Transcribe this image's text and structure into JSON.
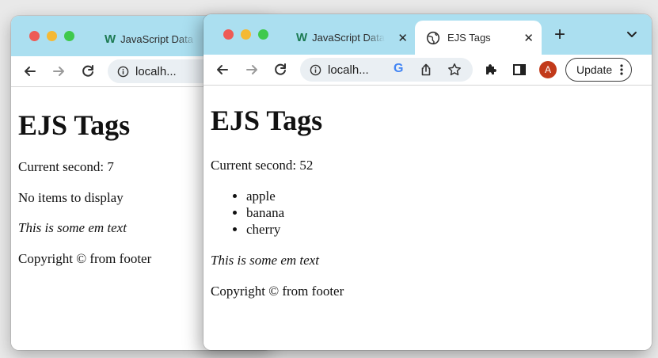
{
  "back_window": {
    "tab_title": "JavaScript Data",
    "address": "localh...",
    "page": {
      "heading": "EJS Tags",
      "current_second": "Current second: 7",
      "empty_message": "No items to display",
      "em_text": "This is some em text",
      "footer": "Copyright © from footer"
    }
  },
  "front_window": {
    "tabs": [
      {
        "title": "JavaScript Data",
        "favicon": "w-icon",
        "active": false
      },
      {
        "title": "EJS Tags",
        "favicon": "globe-icon",
        "active": true
      }
    ],
    "address": "localh...",
    "update_label": "Update",
    "avatar_letter": "A",
    "page": {
      "heading": "EJS Tags",
      "current_second": "Current second: 52",
      "items": [
        "apple",
        "banana",
        "cherry"
      ],
      "em_text": "This is some em text",
      "footer": "Copyright © from footer"
    }
  },
  "colors": {
    "tabstrip": "#abdff0",
    "omnibox": "#eaeff3",
    "avatar": "#c23a1a",
    "close_dot": "#ee5b55",
    "minimize_dot": "#f5b934",
    "zoom_dot": "#3fc94c"
  }
}
